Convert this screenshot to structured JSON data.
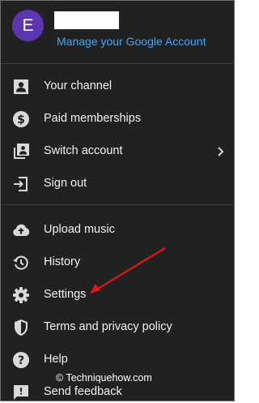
{
  "header": {
    "avatar_letter": "E",
    "manage_account_label": "Manage your Google Account"
  },
  "menu": {
    "items": [
      {
        "label": "Your channel",
        "icon": "person-box-icon"
      },
      {
        "label": "Paid memberships",
        "icon": "dollar-icon"
      },
      {
        "label": "Switch account",
        "icon": "switch-account-icon",
        "has_chevron": true
      },
      {
        "label": "Sign out",
        "icon": "sign-out-icon"
      },
      {
        "label": "Upload music",
        "icon": "cloud-upload-icon"
      },
      {
        "label": "History",
        "icon": "history-icon"
      },
      {
        "label": "Settings",
        "icon": "gear-icon"
      },
      {
        "label": "Terms and privacy policy",
        "icon": "shield-icon"
      },
      {
        "label": "Help",
        "icon": "help-icon"
      },
      {
        "label": "Send feedback",
        "icon": "feedback-icon"
      }
    ]
  },
  "watermark": "© Techniquehow.com",
  "colors": {
    "background": "#212121",
    "text": "#f1f1f1",
    "icon": "#d9d9d9",
    "link": "#3ea6ff",
    "avatar": "#5e35b1",
    "annotation_arrow": "#e01818"
  }
}
